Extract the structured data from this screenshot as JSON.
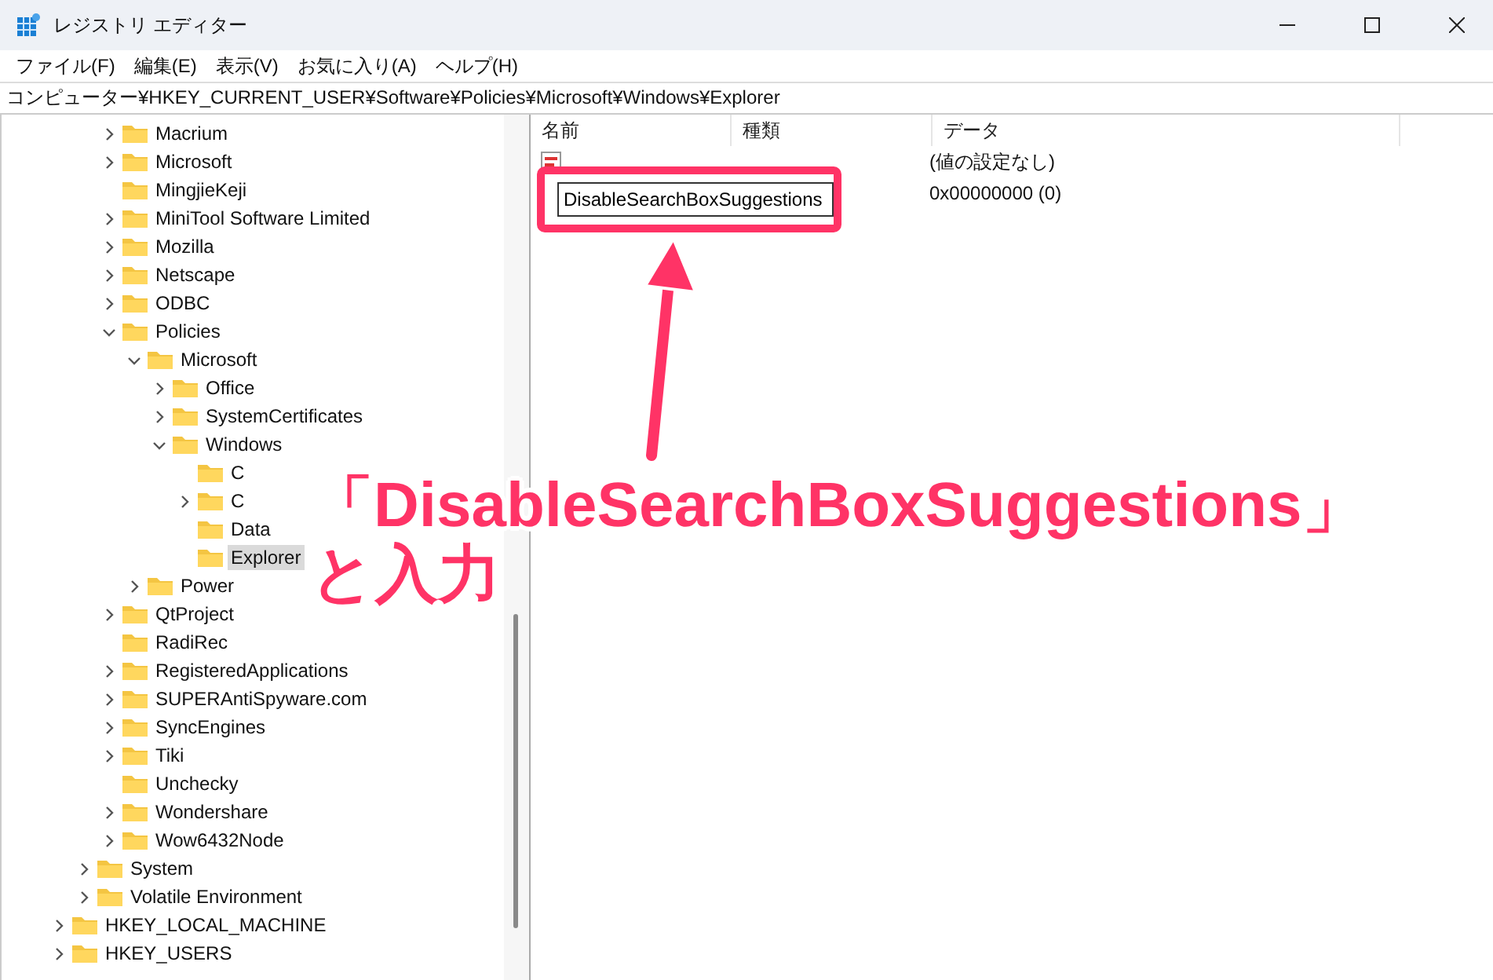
{
  "window": {
    "title": "レジストリ エディター"
  },
  "menu": [
    "ファイル(F)",
    "編集(E)",
    "表示(V)",
    "お気に入り(A)",
    "ヘルプ(H)"
  ],
  "address": "コンピューター¥HKEY_CURRENT_USER¥Software¥Policies¥Microsoft¥Windows¥Explorer",
  "tree": [
    {
      "children": [
        {
          "children": [
            {
              "children": [
                {
                  "label": "Macrium",
                  "expanded": false,
                  "selected": false
                },
                {
                  "label": "Microsoft",
                  "expanded": false,
                  "selected": false
                },
                {
                  "label": "MingjieKeji",
                  "selected": false
                },
                {
                  "label": "MiniTool Software Limited",
                  "expanded": false,
                  "selected": false
                },
                {
                  "label": "Mozilla",
                  "expanded": false,
                  "selected": false
                },
                {
                  "label": "Netscape",
                  "expanded": false,
                  "selected": false
                },
                {
                  "label": "ODBC",
                  "expanded": false,
                  "selected": false
                },
                {
                  "label": "Policies",
                  "expanded": true,
                  "selected": false,
                  "children": [
                    {
                      "label": "Microsoft",
                      "expanded": true,
                      "selected": false,
                      "children": [
                        {
                          "label": "Office",
                          "expanded": false,
                          "selected": false
                        },
                        {
                          "label": "SystemCertificates",
                          "expanded": false,
                          "selected": false
                        },
                        {
                          "label": "Windows",
                          "expanded": true,
                          "selected": false,
                          "children": [
                            {
                              "label": "C",
                              "selected": false
                            },
                            {
                              "label": "C",
                              "expanded": false,
                              "selected": false
                            },
                            {
                              "label": "Data",
                              "selected": false
                            },
                            {
                              "label": "Explorer",
                              "selected": true
                            }
                          ]
                        }
                      ]
                    },
                    {
                      "label": "Power",
                      "expanded": false,
                      "selected": false
                    }
                  ]
                },
                {
                  "label": "QtProject",
                  "expanded": false,
                  "selected": false
                },
                {
                  "label": "RadiRec",
                  "selected": false
                },
                {
                  "label": "RegisteredApplications",
                  "expanded": false,
                  "selected": false
                },
                {
                  "label": "SUPERAntiSpyware.com",
                  "expanded": false,
                  "selected": false
                },
                {
                  "label": "SyncEngines",
                  "expanded": false,
                  "selected": false
                },
                {
                  "label": "Tiki",
                  "expanded": false,
                  "selected": false
                },
                {
                  "label": "Unchecky",
                  "selected": false
                },
                {
                  "label": "Wondershare",
                  "expanded": false,
                  "selected": false
                },
                {
                  "label": "Wow6432Node",
                  "expanded": false,
                  "selected": false
                }
              ]
            },
            {
              "label": "System",
              "expanded": false,
              "selected": false
            },
            {
              "label": "Volatile Environment",
              "expanded": false,
              "selected": false
            }
          ]
        },
        {
          "label": "HKEY_LOCAL_MACHINE",
          "expanded": false,
          "selected": false
        },
        {
          "label": "HKEY_USERS",
          "expanded": false,
          "selected": false
        }
      ]
    }
  ],
  "values": {
    "columns": [
      "名前",
      "種類",
      "データ"
    ],
    "rows": [
      {
        "kind": "string",
        "data": "(値の設定なし)"
      },
      {
        "kind": "dword",
        "editing_name": "DisableSearchBoxSuggestions",
        "data": "0x00000000 (0)"
      }
    ]
  },
  "annotation": {
    "lines": [
      "「DisableSearchBoxSuggestions」",
      "と入力"
    ]
  }
}
